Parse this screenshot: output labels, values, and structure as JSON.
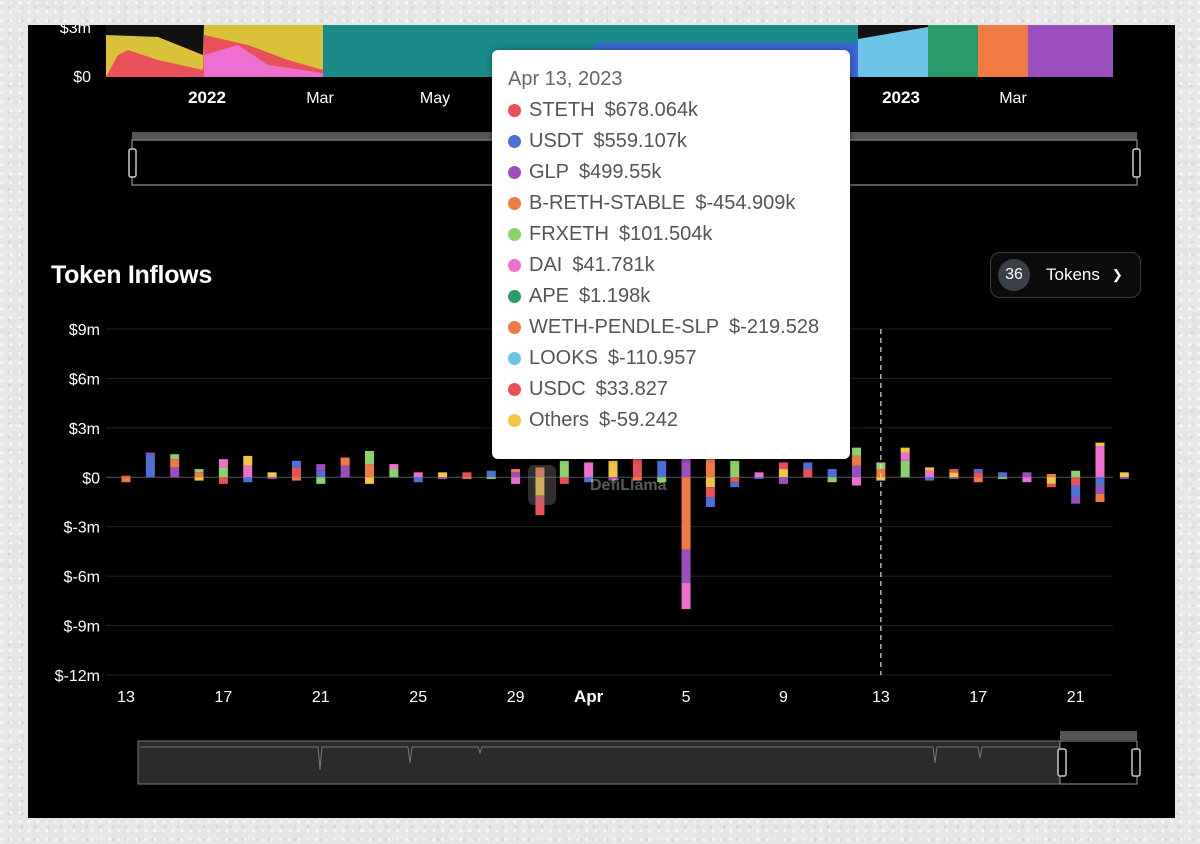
{
  "top_chart": {
    "y_labels": [
      "$3m",
      "$0"
    ],
    "x_labels": [
      "2022",
      "Mar",
      "May",
      "2023",
      "Mar"
    ]
  },
  "title": "Token Inflows",
  "token_selector": {
    "count": "36",
    "label": "Tokens"
  },
  "watermark": "DefiLlama",
  "tooltip": {
    "date": "Apr 13, 2023",
    "rows": [
      {
        "name": "STETH",
        "value": "$678.064k",
        "color": "#e9505a"
      },
      {
        "name": "USDT",
        "value": "$559.107k",
        "color": "#4e6fd3"
      },
      {
        "name": "GLP",
        "value": "$499.55k",
        "color": "#9b4fbf"
      },
      {
        "name": "B-RETH-STABLE",
        "value": "$-454.909k",
        "color": "#f07a44"
      },
      {
        "name": "FRXETH",
        "value": "$101.504k",
        "color": "#8cd16a"
      },
      {
        "name": "DAI",
        "value": "$41.781k",
        "color": "#ef6fd0"
      },
      {
        "name": "APE",
        "value": "$1.198k",
        "color": "#2b9a6a"
      },
      {
        "name": "WETH-PENDLE-SLP",
        "value": "$-219.528",
        "color": "#f07a44"
      },
      {
        "name": "LOOKS",
        "value": "$-110.957",
        "color": "#6bc3e6"
      },
      {
        "name": "USDC",
        "value": "$33.827",
        "color": "#e9505a"
      },
      {
        "name": "Others",
        "value": "$-59.242",
        "color": "#f4c542"
      }
    ]
  },
  "chart_data": {
    "type": "bar",
    "title": "Token Inflows",
    "ylim": [
      -12,
      9
    ],
    "y_ticks": [
      9,
      6,
      3,
      0,
      -3,
      -6,
      -9,
      -12
    ],
    "y_tick_labels": [
      "$9m",
      "$6m",
      "$3m",
      "$0",
      "$-3m",
      "$-6m",
      "$-9m",
      "$-12m"
    ],
    "x_tick_labels": [
      {
        "label": "13",
        "day": 0
      },
      {
        "label": "17",
        "day": 4
      },
      {
        "label": "21",
        "day": 8
      },
      {
        "label": "25",
        "day": 12
      },
      {
        "label": "29",
        "day": 16
      },
      {
        "label": "Apr",
        "day": 19
      },
      {
        "label": "5",
        "day": 23
      },
      {
        "label": "9",
        "day": 27
      },
      {
        "label": "13",
        "day": 31
      },
      {
        "label": "17",
        "day": 35
      },
      {
        "label": "21",
        "day": 39
      }
    ],
    "highlight_day": 31,
    "grid": true,
    "series_colors": [
      "#e9505a",
      "#4e6fd3",
      "#9b4fbf",
      "#f07a44",
      "#8cd16a",
      "#ef6fd0",
      "#f4c542"
    ],
    "bars": [
      {
        "pos": [
          0.1
        ],
        "neg": [
          0.3
        ]
      },
      {
        "pos": [
          1.4,
          0.1
        ],
        "neg": []
      },
      {
        "pos": [
          0.6,
          0.5,
          0.3
        ],
        "neg": []
      },
      {
        "pos": [
          0.3,
          0.2
        ],
        "neg": [
          0.2
        ]
      },
      {
        "pos": [
          0.6,
          0.5
        ],
        "neg": [
          0.4
        ]
      },
      {
        "pos": [
          0.7,
          0.6
        ],
        "neg": [
          0.3
        ]
      },
      {
        "pos": [
          0.3
        ],
        "neg": [
          0.1
        ]
      },
      {
        "pos": [
          0.6,
          0.4
        ],
        "neg": [
          0.2
        ]
      },
      {
        "pos": [
          0.4,
          0.4
        ],
        "neg": [
          0.4
        ]
      },
      {
        "pos": [
          0.7,
          0.5
        ],
        "neg": []
      },
      {
        "pos": [
          0.8,
          0.8
        ],
        "neg": [
          0.4
        ]
      },
      {
        "pos": [
          0.5,
          0.3
        ],
        "neg": []
      },
      {
        "pos": [
          0.3
        ],
        "neg": [
          0.3
        ]
      },
      {
        "pos": [
          0.3
        ],
        "neg": [
          0.1
        ]
      },
      {
        "pos": [
          0.3
        ],
        "neg": [
          0.1
        ]
      },
      {
        "pos": [
          0.4
        ],
        "neg": [
          0.1
        ]
      },
      {
        "pos": [
          0.3,
          0.2
        ],
        "neg": [
          0.4
        ]
      },
      {
        "pos": [
          0.6
        ],
        "neg": [
          1.1,
          1.2
        ]
      },
      {
        "pos": [
          1.0
        ],
        "neg": [
          0.4
        ]
      },
      {
        "pos": [
          0.9
        ],
        "neg": [
          0.3
        ]
      },
      {
        "pos": [
          1.0
        ],
        "neg": [
          0.2
        ]
      },
      {
        "pos": [
          1.1
        ],
        "neg": [
          0.2
        ]
      },
      {
        "pos": [
          1.0
        ],
        "neg": [
          0.3
        ]
      },
      {
        "pos": [
          1.2
        ],
        "neg": [
          4.4,
          2.0,
          1.6
        ]
      },
      {
        "pos": [
          1.1
        ],
        "neg": [
          0.6,
          0.6,
          0.6
        ]
      },
      {
        "pos": [
          1.0
        ],
        "neg": [
          0.3,
          0.3
        ]
      },
      {
        "pos": [
          0.3
        ],
        "neg": [
          0.1
        ]
      },
      {
        "pos": [
          0.5,
          0.4
        ],
        "neg": [
          0.4
        ]
      },
      {
        "pos": [
          0.5,
          0.4
        ],
        "neg": []
      },
      {
        "pos": [
          0.5
        ],
        "neg": [
          0.3
        ]
      },
      {
        "pos": [
          0.7,
          0.6,
          0.5
        ],
        "neg": [
          0.5
        ]
      },
      {
        "pos": [
          0.5,
          0.4
        ],
        "neg": [
          0.2
        ]
      },
      {
        "pos": [
          1.0,
          0.5,
          0.3
        ],
        "neg": []
      },
      {
        "pos": [
          0.4,
          0.2
        ],
        "neg": [
          0.2
        ]
      },
      {
        "pos": [
          0.3,
          0.2
        ],
        "neg": [
          0.1
        ]
      },
      {
        "pos": [
          0.3,
          0.2
        ],
        "neg": [
          0.3
        ]
      },
      {
        "pos": [
          0.3
        ],
        "neg": [
          0.1
        ]
      },
      {
        "pos": [
          0.3
        ],
        "neg": [
          0.3
        ]
      },
      {
        "pos": [
          0.2
        ],
        "neg": [
          0.4,
          0.2
        ]
      },
      {
        "pos": [
          0.4
        ],
        "neg": [
          0.5,
          0.7,
          0.4
        ]
      },
      {
        "pos": [
          1.9,
          0.2
        ],
        "neg": [
          0.5,
          0.5,
          0.5
        ]
      },
      {
        "pos": [
          0.3
        ],
        "neg": [
          0.1
        ]
      }
    ]
  }
}
